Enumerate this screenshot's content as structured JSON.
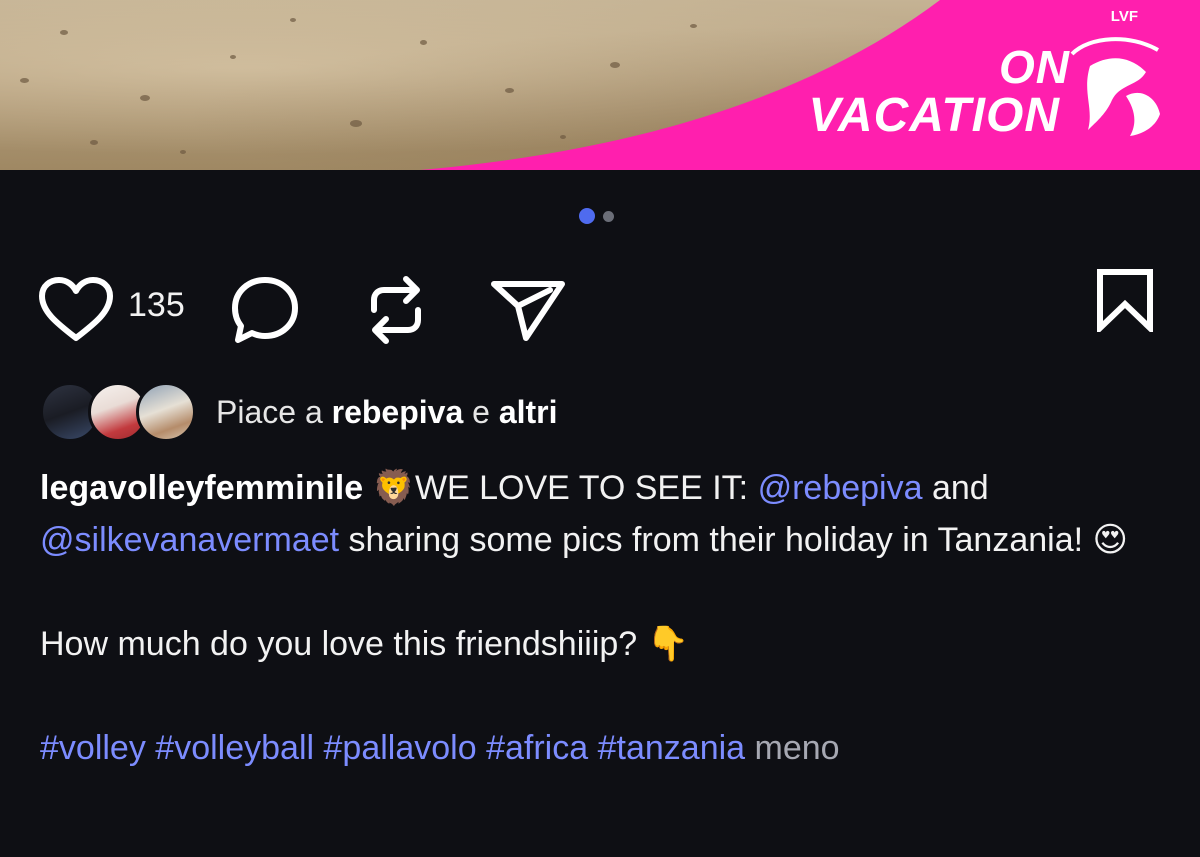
{
  "banner": {
    "lvf": "LVF",
    "line1": "ON",
    "line2": "VACATION",
    "color": "#ff1fae"
  },
  "carousel": {
    "active": 1,
    "total": 2
  },
  "actions": {
    "like_count": "135",
    "icons": [
      "heart-icon",
      "comment-icon",
      "repost-icon",
      "share-icon",
      "bookmark-icon"
    ]
  },
  "liked_by": {
    "prefix": "Piace a",
    "user": "rebepiva",
    "joiner": "e",
    "others": "altri"
  },
  "caption": {
    "username": "legavolleyfemminile",
    "emoji_lion": "🦁",
    "text1": "WE LOVE TO SEE IT:",
    "mention1": "@rebepiva",
    "and": "and",
    "mention2": "@silkevanavermaet",
    "text2": "sharing some pics from their holiday in Tanzania!",
    "emoji_heart_eyes": "😍",
    "question": "How much do you love this friendshiiip?",
    "emoji_point": "👇",
    "hashtags": [
      "#volley",
      "#volleyball",
      "#pallavolo",
      "#africa",
      "#tanzania"
    ],
    "less": "meno"
  }
}
